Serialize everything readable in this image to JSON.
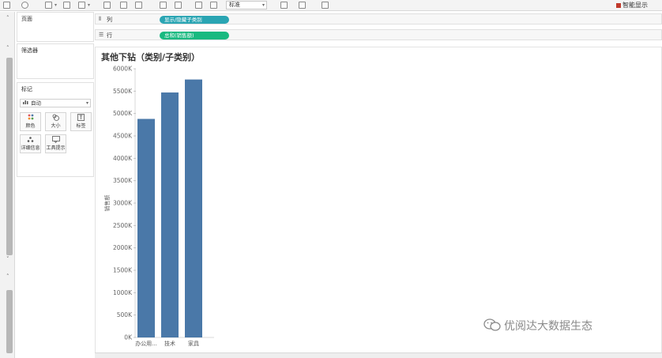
{
  "toolbar": {
    "format_value": "标准",
    "smart_show_label": "智能显示"
  },
  "left_panel": {
    "pages_title": "页面",
    "filters_title": "筛选器",
    "marks": {
      "title": "标记",
      "mark_type": "自动",
      "cards": [
        {
          "label": "颜色",
          "icon": "color-dots-icon"
        },
        {
          "label": "大小",
          "icon": "size-icon"
        },
        {
          "label": "标签",
          "icon": "label-icon"
        },
        {
          "label": "详细信息",
          "icon": "detail-icon"
        },
        {
          "label": "工具提示",
          "icon": "tooltip-icon"
        }
      ]
    }
  },
  "shelves": {
    "columns_label": "列",
    "columns_pill": "显示/隐藏子类别",
    "rows_label": "行",
    "rows_pill": "总和(销售额)"
  },
  "view": {
    "title": "其他下钻（类别/子类别）"
  },
  "chart_data": {
    "type": "bar",
    "categories": [
      "办公用...",
      "技术",
      "家具"
    ],
    "values": [
      4880,
      5470,
      5760
    ],
    "ylabel": "销售额",
    "ylim": [
      0,
      6000
    ],
    "yticks": [
      "0K",
      "500K",
      "1000K",
      "1500K",
      "2000K",
      "2500K",
      "3000K",
      "3500K",
      "4000K",
      "4500K",
      "5000K",
      "5500K",
      "6000K"
    ],
    "unit": "K",
    "bar_color": "#4a78a8",
    "grid": false
  },
  "watermark": {
    "text": "优阅达大数据生态",
    "icon": "wechat-icon"
  },
  "colors": {
    "dimension_pill": "#2aa5b3",
    "measure_pill": "#19b980",
    "bar": "#4a78a8"
  }
}
